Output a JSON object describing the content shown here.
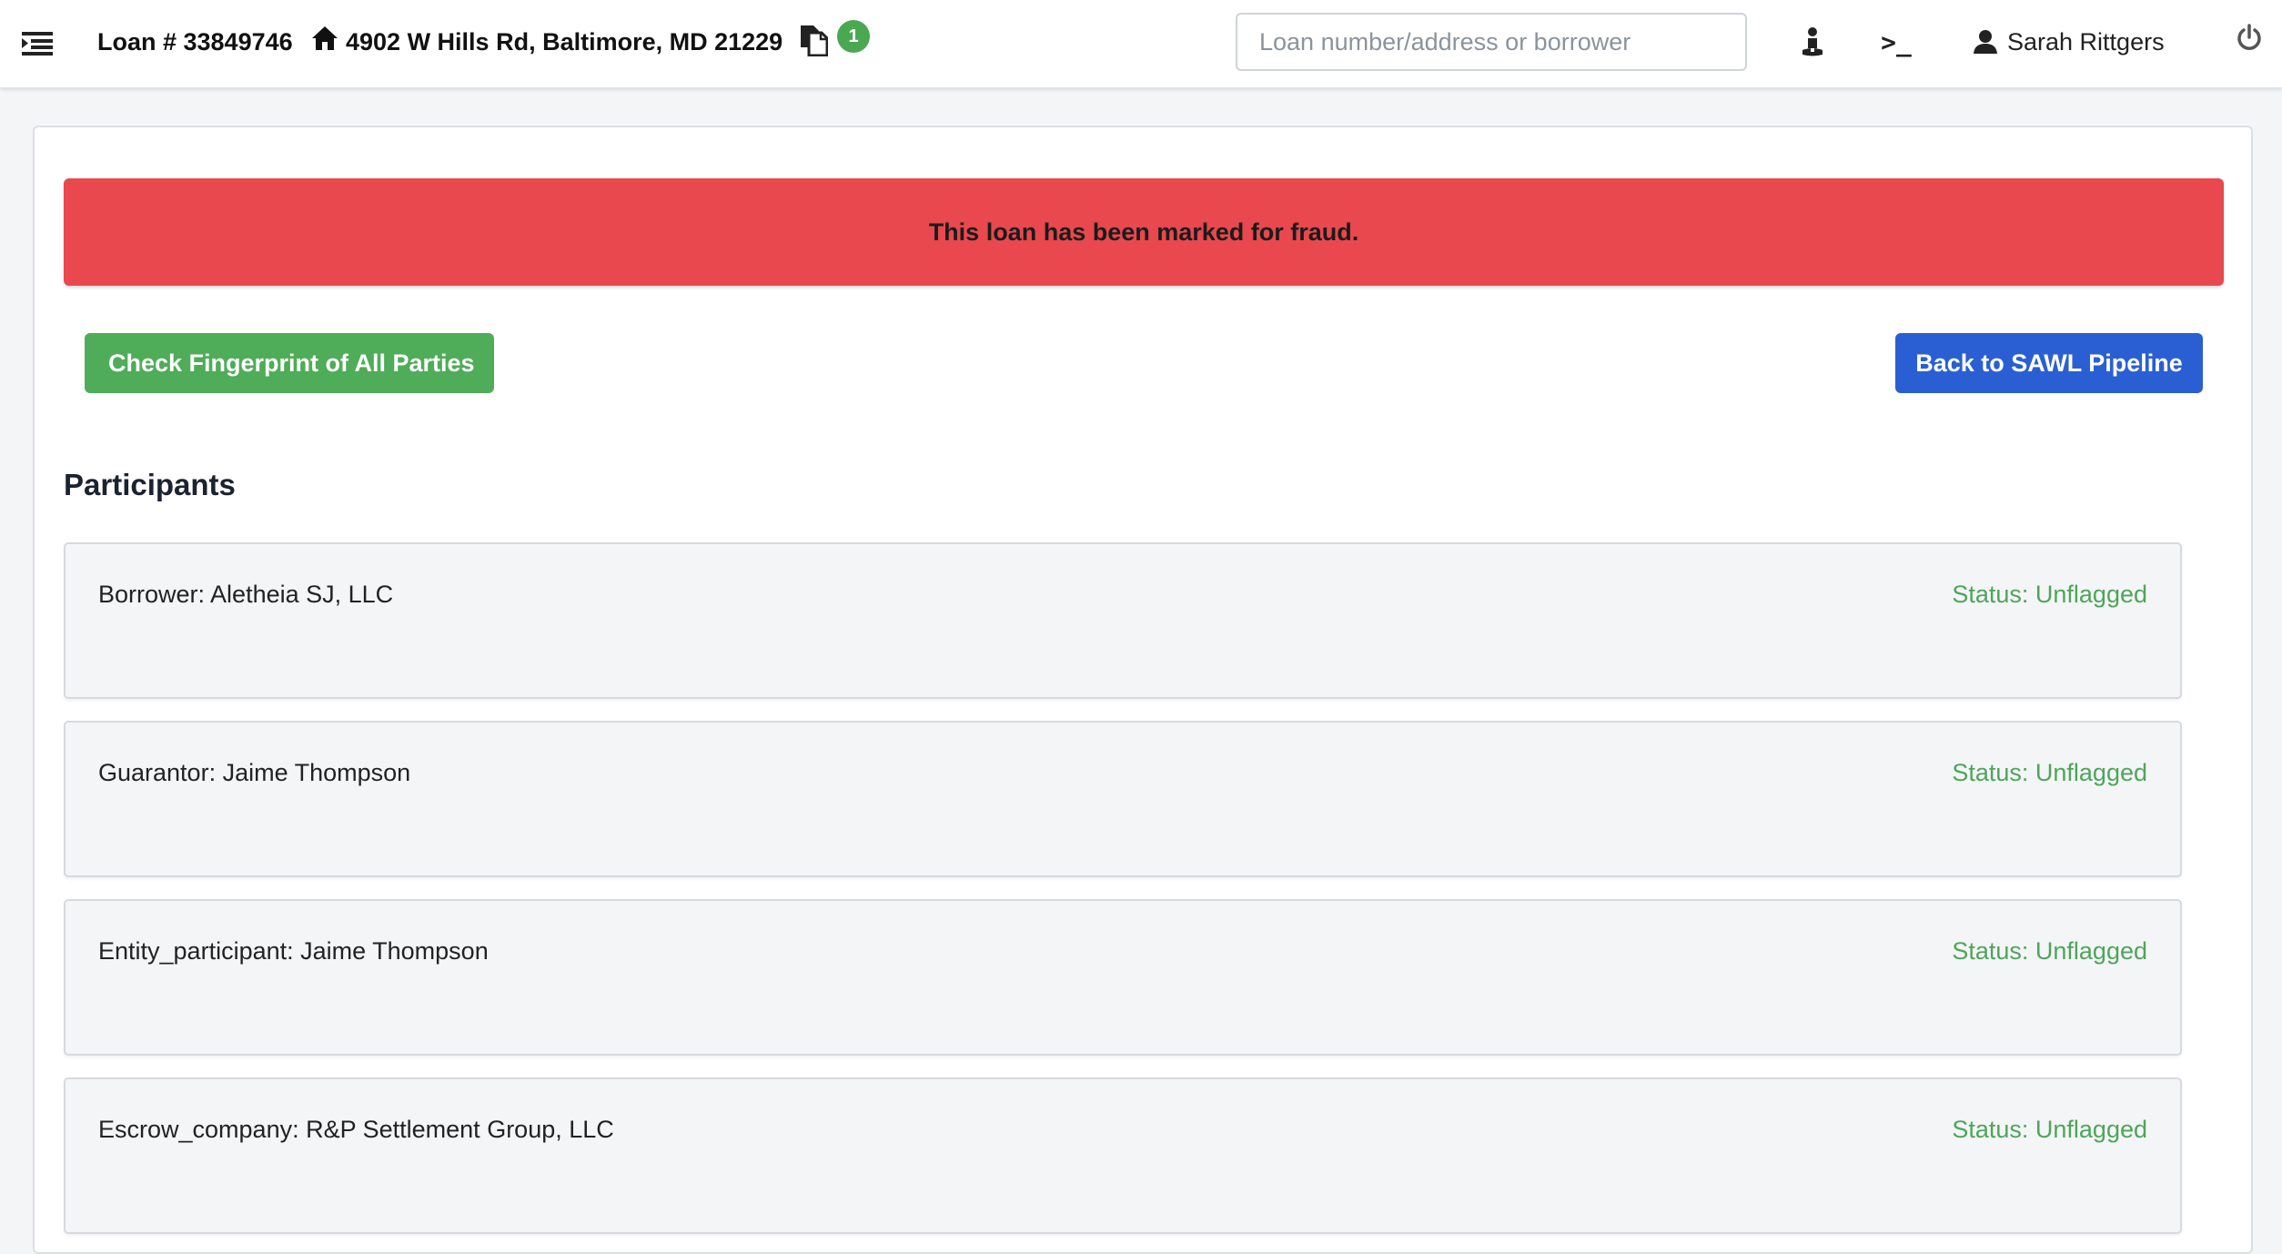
{
  "header": {
    "loan_label": "Loan # 33849746",
    "address": "4902 W Hills Rd, Baltimore, MD 21229",
    "docs_badge_count": "1",
    "search_placeholder": "Loan number/address or borrower",
    "terminal_glyph": ">_",
    "user_name": "Sarah Rittgers"
  },
  "alert": {
    "message": "This loan has been marked for fraud.",
    "color": "#e8484e"
  },
  "actions": {
    "fingerprint_label": "Check Fingerprint of All Parties",
    "fingerprint_color": "#4fac58",
    "back_label": "Back to SAWL Pipeline",
    "back_color": "#2a5fd4"
  },
  "participants_section": {
    "title": "Participants",
    "items": [
      {
        "label": "Borrower: Aletheia SJ, LLC",
        "status": "Status: Unflagged"
      },
      {
        "label": "Guarantor: Jaime Thompson",
        "status": "Status: Unflagged"
      },
      {
        "label": "Entity_participant: Jaime Thompson",
        "status": "Status: Unflagged"
      },
      {
        "label": "Escrow_company: R&P Settlement Group, LLC",
        "status": "Status: Unflagged"
      }
    ],
    "status_color": "#4ea55a"
  },
  "icons": {
    "menu": "menu-toggle-icon",
    "home": "home-icon",
    "docs": "documents-icon",
    "user_tool": "person-icon",
    "terminal": "terminal-icon",
    "user": "user-icon",
    "power": "power-icon"
  }
}
